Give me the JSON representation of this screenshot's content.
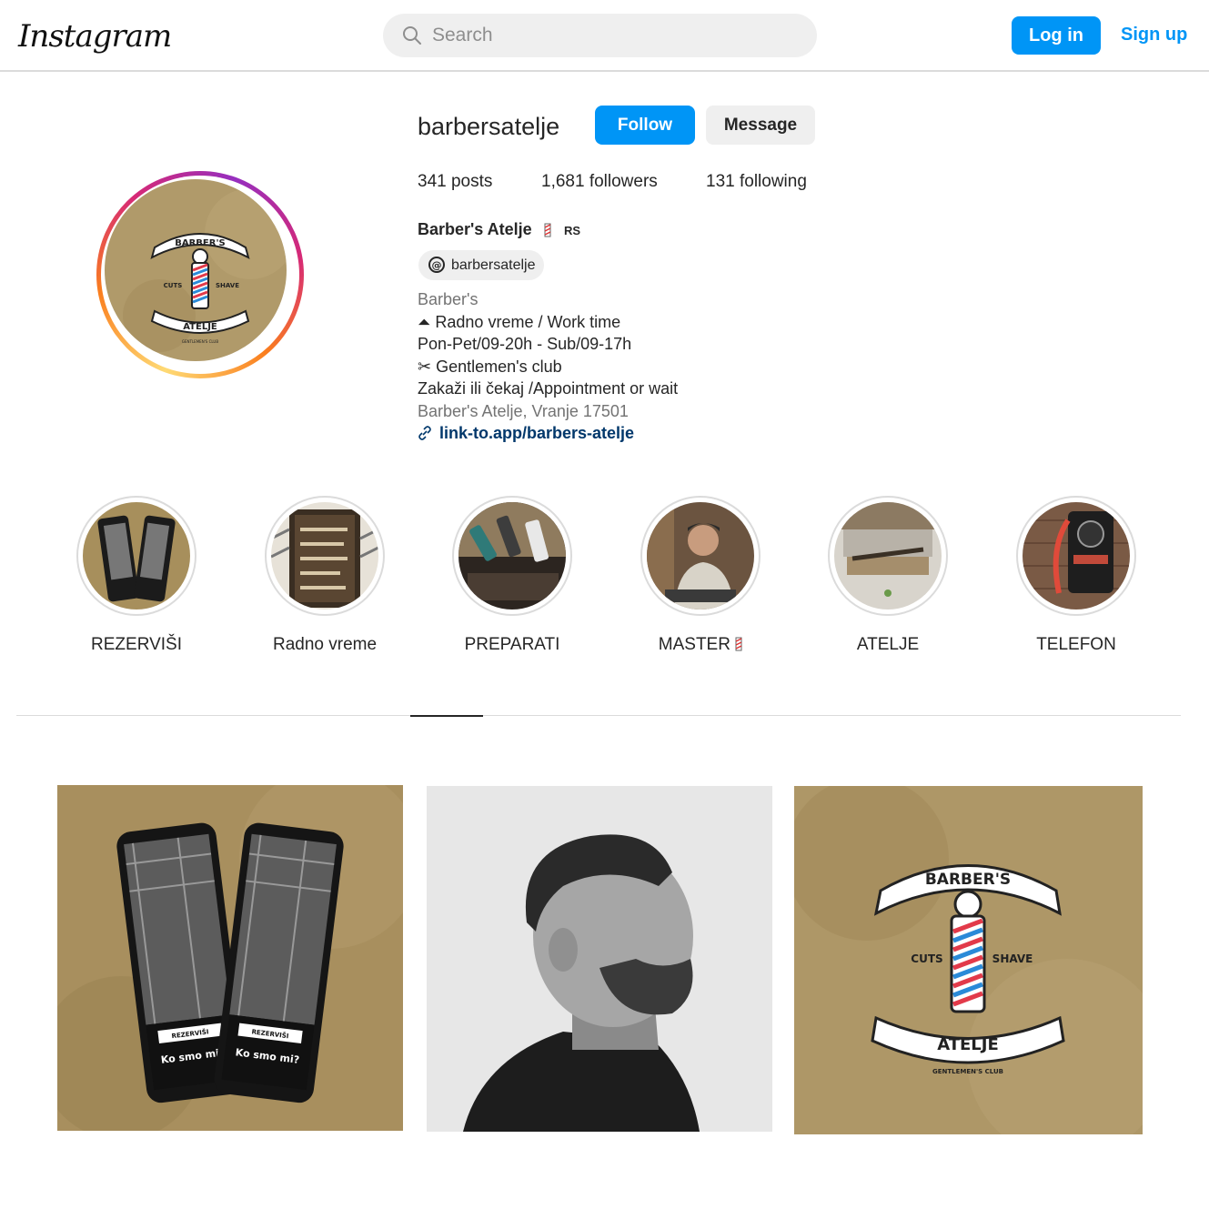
{
  "header": {
    "logo_text": "Instagram",
    "search_placeholder": "Search",
    "login_label": "Log in",
    "signup_label": "Sign up",
    "accent_color": "#0095f6"
  },
  "profile": {
    "username": "barbersatelje",
    "follow_label": "Follow",
    "message_label": "Message",
    "posts": "341 posts",
    "followers": "1,681 followers",
    "following": "131 following",
    "display_name": "Barber's Atelje",
    "country_badge": "RS",
    "threads_handle": "barbersatelje",
    "category": "Barber's",
    "bio_lines": [
      "⏶ Radno vreme / Work time",
      "Pon-Pet/09-20h - Sub/09-17h",
      "✂ Gentlemen's club",
      "Zakaži ili čekaj /Appointment or wait"
    ],
    "location": "Barber's Atelje, Vranje 17501",
    "link": "link-to.app/barbers-atelje"
  },
  "avatar_logo": {
    "top": "BARBER'S",
    "left": "CUTS",
    "right": "SHAVE",
    "bottom": "ATELJE",
    "tagline": "GENTLEMEN'S CLUB"
  },
  "highlights": [
    {
      "label": "REZERVIŠI",
      "icon": "phones-thumbnail"
    },
    {
      "label": "Radno vreme",
      "icon": "hours-board-thumbnail"
    },
    {
      "label": "PREPARATI",
      "icon": "products-thumbnail"
    },
    {
      "label": "MASTER",
      "icon": "barber-photo-thumbnail"
    },
    {
      "label": "ATELJE",
      "icon": "shop-interior-thumbnail"
    },
    {
      "label": "TELEFON",
      "icon": "telephone-thumbnail"
    }
  ],
  "posts": [
    {
      "icon": "app-phones-post",
      "screen_title": "Ko smo mi?",
      "screen_button": "REZERVIŠI"
    },
    {
      "icon": "haircut-profile-photo-post"
    },
    {
      "icon": "barbers-atelje-logo-post"
    }
  ]
}
